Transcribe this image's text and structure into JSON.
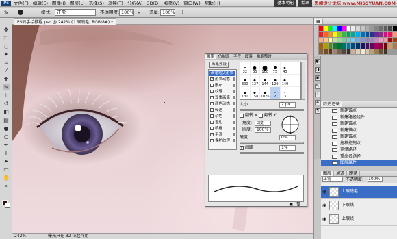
{
  "menubar": {
    "items": [
      "文件(F)",
      "编辑(E)",
      "图像(I)",
      "图层(L)",
      "选择(S)",
      "滤镜(T)",
      "分析(A)",
      "3D(D)",
      "视图(V)",
      "窗口(W)",
      "帮助(H)"
    ],
    "workspace": "基本功能",
    "workspace2": "绘画",
    "watermark": "思绪设计论坛 www.MISSYUAN.COM"
  },
  "optionsbar": {
    "mode_label": "模式:",
    "mode_value": "正常",
    "opacity_label": "不透明度:",
    "opacity_value": "100%",
    "flow_label": "流量:",
    "flow_value": "100%"
  },
  "document": {
    "tab_title": "PS转手绘教程.psd @ 242% (上眼睫毛, RGB/8#) *",
    "zoom": "242%",
    "status": "曝光只在 32 位起作用"
  },
  "brush_panel": {
    "tabs": [
      "画笔",
      "仿制源",
      "字符",
      "段落",
      "画笔预设"
    ],
    "active_tab": "画笔",
    "preset_button": "画笔预设",
    "options": [
      {
        "label": "画笔笔尖形状",
        "checked": false,
        "selected": true
      },
      {
        "label": "形状动态",
        "checked": true
      },
      {
        "label": "散布",
        "checked": false
      },
      {
        "label": "纹理",
        "checked": false
      },
      {
        "label": "双重画笔",
        "checked": false
      },
      {
        "label": "颜色动态",
        "checked": false
      },
      {
        "label": "传递",
        "checked": false
      },
      {
        "label": "杂色",
        "checked": false
      },
      {
        "label": "湿边",
        "checked": false
      },
      {
        "label": "喷枪",
        "checked": false
      },
      {
        "label": "平滑",
        "checked": true
      },
      {
        "label": "保护纹理",
        "checked": false
      }
    ],
    "tips": [
      {
        "n": "32",
        "s": 2
      },
      {
        "n": "55",
        "s": 5
      },
      {
        "n": "100",
        "s": 7
      },
      {
        "n": "75",
        "s": 4
      },
      {
        "n": "45",
        "s": 3
      },
      {
        "n": "",
        "s": 0
      },
      {
        "n": "300",
        "s": 3
      },
      {
        "n": "137",
        "s": 3
      },
      {
        "n": "144",
        "s": 3
      },
      {
        "n": "129",
        "s": 3
      },
      {
        "n": "149",
        "s": 3
      },
      {
        "n": "",
        "s": 0
      },
      {
        "n": "131",
        "s": 3
      },
      {
        "n": "158",
        "s": 3
      },
      {
        "n": "1026",
        "s": 3
      },
      {
        "n": "2",
        "s": 1
      },
      {
        "n": "3",
        "s": 1
      },
      {
        "n": "",
        "s": 0
      }
    ],
    "size_label": "大小",
    "size_value": "2 px",
    "flip_x": "翻转 X",
    "flip_y": "翻转 Y",
    "angle_label": "角度:",
    "angle_value": "0度",
    "roundness_label": "圆度:",
    "roundness_value": "100%",
    "hardness_label": "硬度",
    "hardness_value": "0%",
    "spacing_label": "间距",
    "spacing_value": "1%"
  },
  "history": {
    "tabs": [
      "历史记录"
    ],
    "items": [
      "新建锚点",
      "新建路径组件",
      "新建锚点",
      "新建锚点",
      "新建锚点",
      "拖移控制点",
      "存储路径",
      "重命名路径",
      "图层属性"
    ],
    "selected_index": 8
  },
  "layers": {
    "tabs": [
      "图层",
      "通道",
      "路径"
    ],
    "blend_mode": "正常",
    "opacity_label": "不透明度:",
    "opacity_value": "100%",
    "fill_label": "填充:",
    "fill_value": "100%",
    "items": [
      "上眼睫毛",
      "下眼线",
      "上眼线"
    ],
    "selected_index": 0
  },
  "colors": {
    "accent": "#3a6ec6",
    "skin": "#e8cfd2",
    "iris": "#5a4e80"
  }
}
